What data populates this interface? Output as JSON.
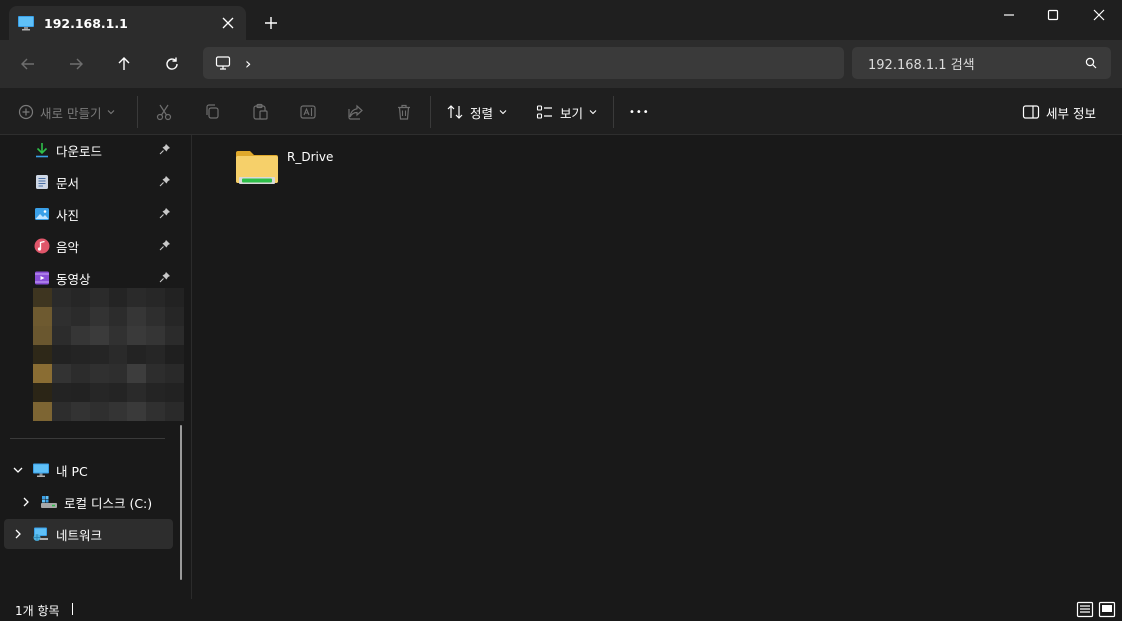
{
  "window": {
    "tab_title": "192.168.1.1",
    "new_tab_symbol": "+"
  },
  "navigation": {
    "address_separator": "›",
    "search_placeholder": "192.168.1.1 검색"
  },
  "toolbar": {
    "new_label": "새로 만들기",
    "sort_label": "정렬",
    "view_label": "보기",
    "more_label": "•••",
    "details_label": "세부 정보"
  },
  "sidebar": {
    "quick_access": [
      {
        "label": "다운로드",
        "icon": "download-icon",
        "pinned": true
      },
      {
        "label": "문서",
        "icon": "documents-icon",
        "pinned": true
      },
      {
        "label": "사진",
        "icon": "pictures-icon",
        "pinned": true
      },
      {
        "label": "음악",
        "icon": "music-icon",
        "pinned": true
      },
      {
        "label": "동영상",
        "icon": "videos-icon",
        "pinned": true
      }
    ],
    "tree": {
      "this_pc": "내 PC",
      "local_disk": "로컬 디스크 (C:)",
      "network": "네트워크"
    }
  },
  "content": {
    "items": [
      {
        "name": "R_Drive",
        "icon": "network-drive-folder-icon"
      }
    ]
  },
  "status": {
    "item_count": "1개 항목"
  },
  "colors": {
    "background": "#191919",
    "toolbar": "#1f1f1f",
    "navbar": "#2c2c2c",
    "field": "#3a3a3a",
    "folder_yellow": "#f3c54a",
    "drive_green": "#2fbf4a",
    "accent_blue": "#3aa0e8"
  }
}
